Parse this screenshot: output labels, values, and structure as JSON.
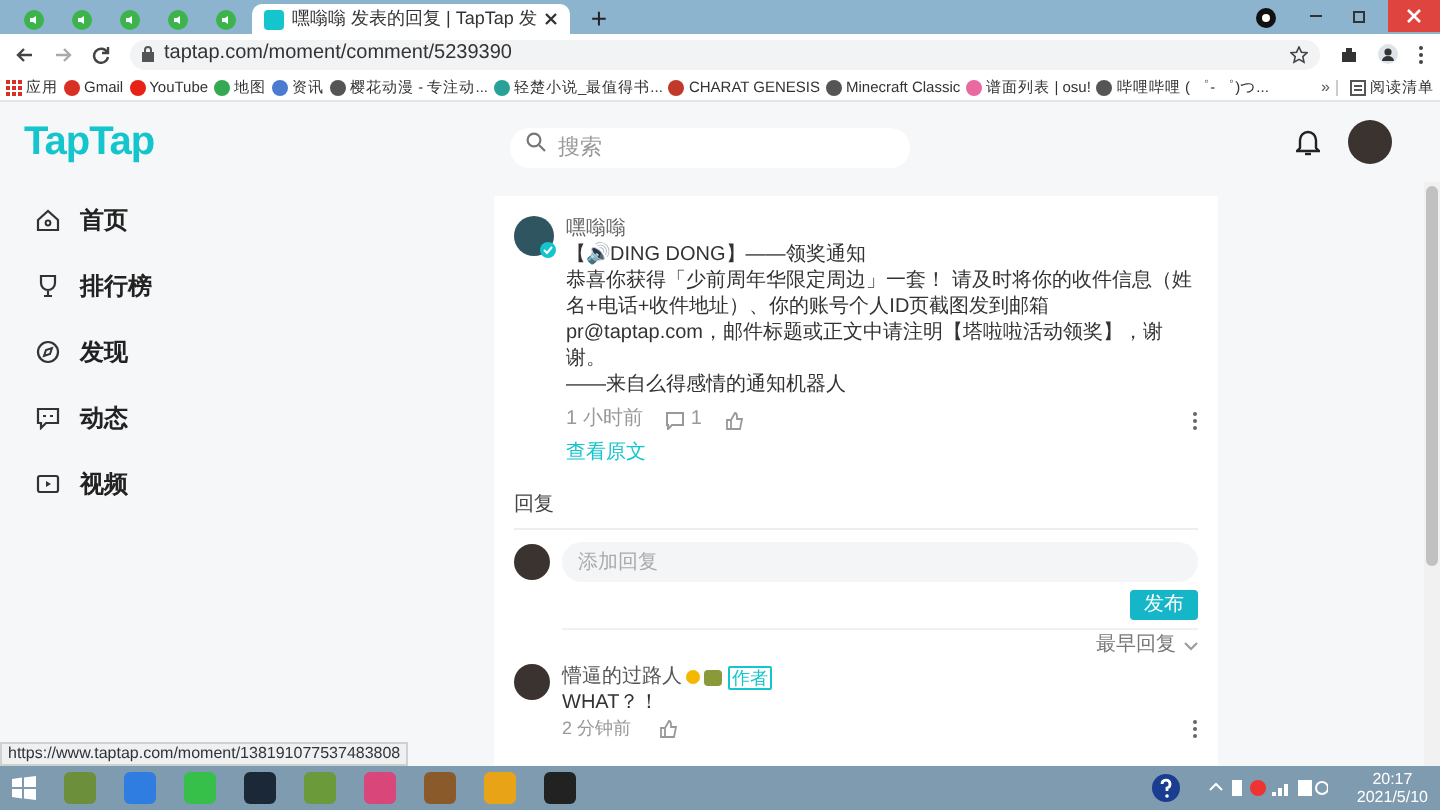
{
  "browser": {
    "tabs": [
      {
        "selected": false
      },
      {
        "selected": false
      },
      {
        "selected": false
      },
      {
        "selected": false
      },
      {
        "selected": false
      },
      {
        "title": "嘿嗡嗡 发表的回复 | TapTap 发",
        "selected": true
      }
    ],
    "new_tab": "+",
    "url": "taptap.com/moment/comment/5239390",
    "bookmarks": [
      "应用",
      "Gmail",
      "YouTube",
      "地图",
      "资讯",
      "樱花动漫 - 专注动...",
      "轻楚小说_最值得书...",
      "CHARAT GENESIS",
      "Minecraft Classic",
      "谱面列表 | osu!",
      "哔哩哔哩 ( ゜- ゜)つ..."
    ],
    "bookmarks_more": "»",
    "reading_list": "阅读清单"
  },
  "page": {
    "logo": "TapTap",
    "search": {
      "placeholder": "搜索"
    },
    "sidebar": {
      "items": [
        {
          "label": "首页"
        },
        {
          "label": "排行榜"
        },
        {
          "label": "发现"
        },
        {
          "label": "动态"
        },
        {
          "label": "视频"
        }
      ]
    },
    "post": {
      "author": "嘿嗡嗡",
      "verified": true,
      "lines": [
        "【🔊DING DONG】——领奖通知",
        "恭喜你获得「少前周年华限定周边」一套！ 请及时将你的收件信息（姓名+电话+收件地址）、你的账号个人ID页截图发到邮箱pr@taptap.com，邮件标题或正文中请注明【塔啦啦活动领奖】，谢谢。",
        "——来自么得感情的通知机器人"
      ],
      "time": "1 小时前",
      "comments": "1",
      "view_original": "查看原文"
    },
    "replies": {
      "heading": "回复",
      "input": {
        "placeholder": "添加回复"
      },
      "submit": "发布",
      "sort": "最早回复",
      "items": [
        {
          "author": "懵逼的过路人",
          "badge": "作者",
          "text": "WHAT？！",
          "time": "2 分钟前"
        }
      ]
    }
  },
  "status_url": "https://www.taptap.com/moment/138191077537483808",
  "taskbar": {
    "time": "20:17",
    "date": "2021/5/10"
  }
}
